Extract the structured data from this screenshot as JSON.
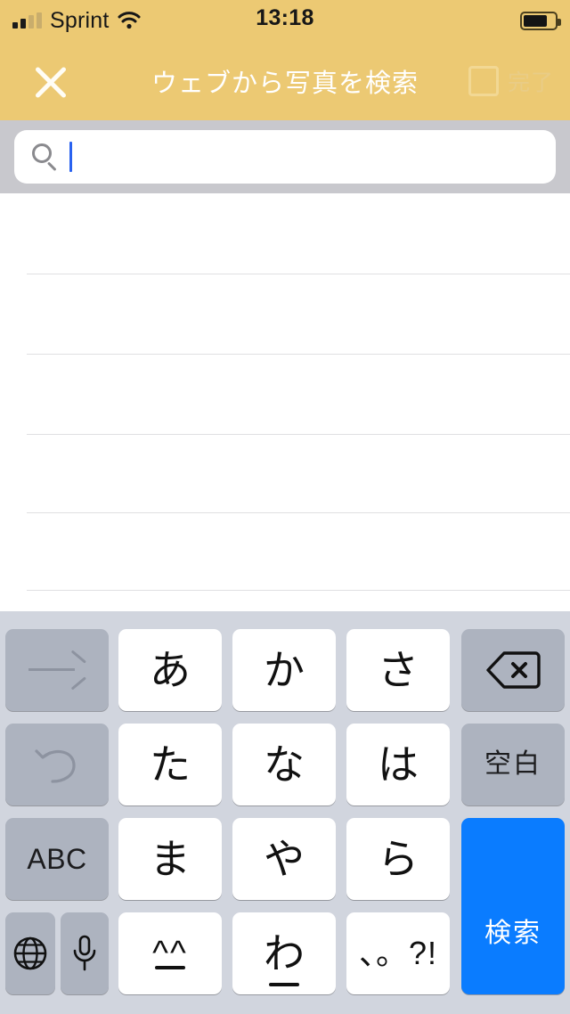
{
  "status_bar": {
    "carrier": "Sprint",
    "time": "13:18",
    "signal_icon": "signal-bars-icon",
    "wifi_icon": "wifi-icon",
    "battery_icon": "battery-icon",
    "battery_level_percent": 75
  },
  "nav_bar": {
    "title": "ウェブから写真を検索",
    "close_icon": "close-x-icon",
    "checkbox_icon": "checkbox-empty-icon",
    "done_label": "完了",
    "background_color": "#ecc973",
    "title_color": "#ffffff",
    "done_color": "#e9cc86"
  },
  "search": {
    "value": "",
    "placeholder": "",
    "icon": "search-magnifier-icon",
    "caret_color": "#2962f0",
    "bar_background": "#c8c8cd"
  },
  "results": {
    "items": [],
    "separator_count": 5,
    "separator_color": "#e0e0e2"
  },
  "keyboard": {
    "background_color": "#d1d5de",
    "accent_color": "#0a7cff",
    "rows": [
      [
        {
          "name": "next-candidate-key",
          "label": "→",
          "icon": "arrow-right-icon",
          "style": "gray-dim"
        },
        {
          "name": "key-a-row",
          "label": "あ",
          "style": "white"
        },
        {
          "name": "key-ka-row",
          "label": "か",
          "style": "white"
        },
        {
          "name": "key-sa-row",
          "label": "さ",
          "style": "white"
        },
        {
          "name": "delete-key",
          "label": "⌫",
          "icon": "delete-backspace-icon",
          "style": "gray"
        }
      ],
      [
        {
          "name": "undo-key",
          "label": "↺",
          "icon": "undo-arrow-icon",
          "style": "gray-dim"
        },
        {
          "name": "key-ta-row",
          "label": "た",
          "style": "white"
        },
        {
          "name": "key-na-row",
          "label": "な",
          "style": "white"
        },
        {
          "name": "key-ha-row",
          "label": "は",
          "style": "white"
        },
        {
          "name": "space-key",
          "label": "空白",
          "style": "gray"
        }
      ],
      [
        {
          "name": "abc-key",
          "label": "ABC",
          "style": "gray"
        },
        {
          "name": "key-ma-row",
          "label": "ま",
          "style": "white"
        },
        {
          "name": "key-ya-row",
          "label": "や",
          "style": "white"
        },
        {
          "name": "key-ra-row",
          "label": "ら",
          "style": "white"
        },
        {
          "name": "search-key",
          "label": "検索",
          "style": "blue"
        }
      ],
      [
        {
          "name": "globe-key",
          "label": "",
          "icon": "globe-icon",
          "style": "gray"
        },
        {
          "name": "dictation-key",
          "label": "",
          "icon": "microphone-icon",
          "style": "gray"
        },
        {
          "name": "emoticon-key",
          "label": "^^",
          "style": "white"
        },
        {
          "name": "key-wa-row",
          "label": "わ",
          "style": "white"
        },
        {
          "name": "punctuation-key",
          "label": "、。?!",
          "style": "white"
        }
      ]
    ]
  }
}
